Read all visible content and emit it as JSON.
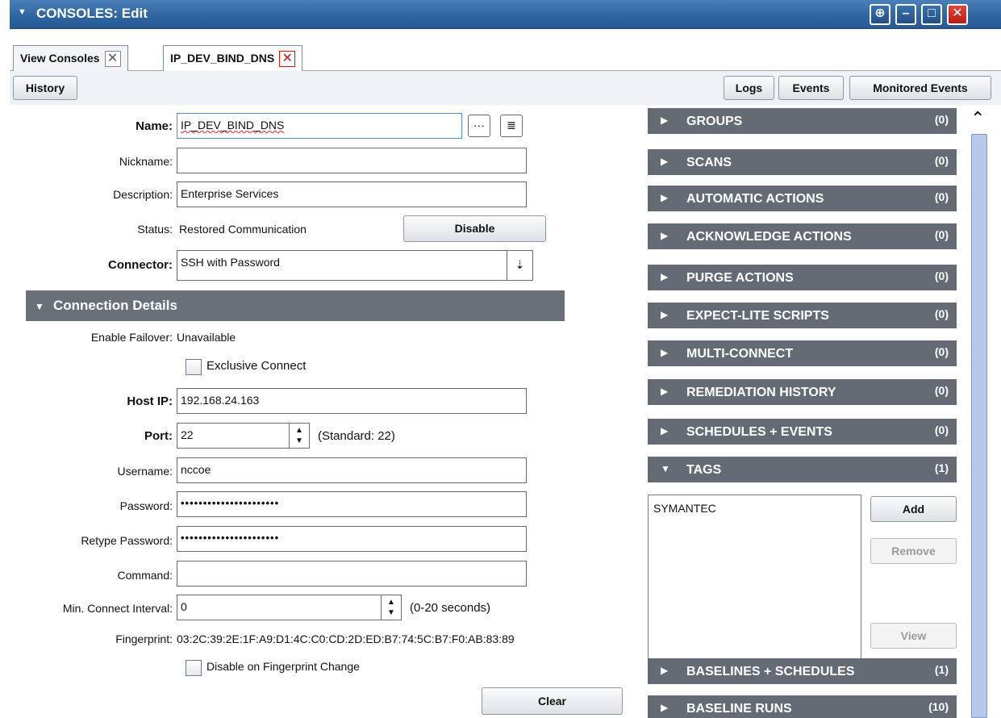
{
  "window": {
    "title": "CONSOLES: Edit"
  },
  "tabs": [
    {
      "label": "View Consoles"
    },
    {
      "label": "IP_DEV_BIND_DNS"
    }
  ],
  "toolbar": {
    "history": "History",
    "logs": "Logs",
    "events": "Events",
    "monitored_events": "Monitored Events"
  },
  "form": {
    "name_label": "Name:",
    "name_value": "IP_DEV_BIND_DNS",
    "nickname_label": "Nickname:",
    "nickname_value": "",
    "description_label": "Description:",
    "description_value": "Enterprise Services",
    "status_label": "Status:",
    "status_value": "Restored Communication",
    "disable_button": "Disable",
    "connector_label": "Connector:",
    "connector_value": "SSH with Password"
  },
  "connection": {
    "section_title": "Connection Details",
    "failover_label": "Enable Failover:",
    "failover_value": "Unavailable",
    "exclusive_connect": "Exclusive Connect",
    "host_ip_label": "Host IP:",
    "host_ip_value": "192.168.24.163",
    "port_label": "Port:",
    "port_value": "22",
    "port_hint": "(Standard: 22)",
    "username_label": "Username:",
    "username_value": "nccoe",
    "password_label": "Password:",
    "password_value": "••••••••••••••••••••••",
    "retype_label": "Retype Password:",
    "retype_value": "••••••••••••••••••••••",
    "command_label": "Command:",
    "command_value": "",
    "interval_label": "Min. Connect Interval:",
    "interval_value": "0",
    "interval_hint": "(0-20 seconds)",
    "fingerprint_label": "Fingerprint:",
    "fingerprint_value": "03:2C:39:2E:1F:A9:D1:4C:C0:CD:2D:ED:B7:74:5C:B7:F0:AB:83:89",
    "disable_on_change": "Disable on Fingerprint Change",
    "clear_button": "Clear"
  },
  "accordion": [
    {
      "label": "GROUPS",
      "count": "(0)"
    },
    {
      "label": "SCANS",
      "count": "(0)"
    },
    {
      "label": "AUTOMATIC ACTIONS",
      "count": "(0)"
    },
    {
      "label": "ACKNOWLEDGE ACTIONS",
      "count": "(0)"
    },
    {
      "label": "PURGE ACTIONS",
      "count": "(0)"
    },
    {
      "label": "EXPECT-LITE SCRIPTS",
      "count": "(0)"
    },
    {
      "label": "MULTI-CONNECT",
      "count": "(0)"
    },
    {
      "label": "REMEDIATION HISTORY",
      "count": "(0)"
    },
    {
      "label": "SCHEDULES + EVENTS",
      "count": "(0)"
    },
    {
      "label": "TAGS",
      "count": "(1)"
    },
    {
      "label": "BASELINES + SCHEDULES",
      "count": "(1)"
    },
    {
      "label": "BASELINE RUNS",
      "count": "(10)"
    }
  ],
  "tags": {
    "items": [
      "SYMANTEC"
    ],
    "add": "Add",
    "remove": "Remove",
    "view": "View"
  }
}
